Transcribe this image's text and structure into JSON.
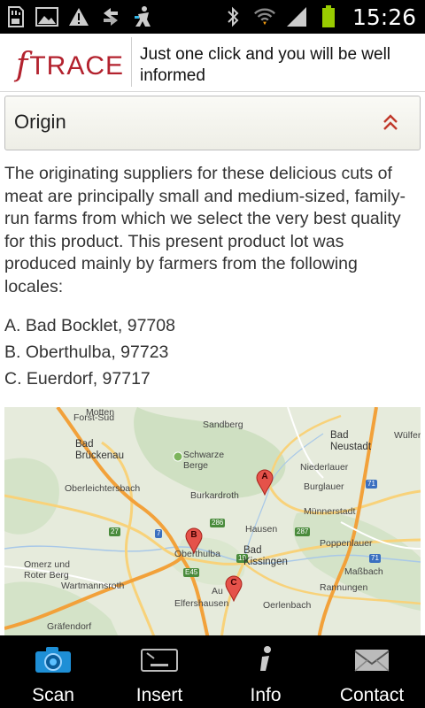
{
  "status_bar": {
    "time": "15:26"
  },
  "header": {
    "logo_f": "f",
    "logo_text": "TRACE",
    "tagline": "Just one click and you will be well informed"
  },
  "section": {
    "title": "Origin"
  },
  "body_text": "The originating suppliers for these delicious cuts of meat are principally small and medium-sized, family-run farms from which we select the very best quality for this product. This present product lot was produced mainly by farmers from the following locales:",
  "locales": [
    "A. Bad Bocklet, 97708",
    "B. Oberthulba, 97723",
    "C. Euerdorf, 97717"
  ],
  "map": {
    "markers": [
      "A",
      "B",
      "C"
    ],
    "place_labels": {
      "motten": "Motten",
      "forst_sud": "Forst-Sud",
      "sandberg": "Sandberg",
      "bad_neustadt": "Bad\nNeustadt",
      "wulfershausen": "Wülfers",
      "bad_bruckenau": "Bad\nBrückenau",
      "schwarze_berge": "Schwarze\nBerge",
      "niederlauer": "Niederlauer",
      "burglauer": "Burglauer",
      "oberleichtersbach": "Oberleichtersbach",
      "burkardroth": "Burkardroth",
      "munnerstadt": "Münnerstadt",
      "hausen": "Hausen",
      "bad_kissingen": "Bad\nKissingen",
      "poppenlauer": "Poppenlauer",
      "omerz": "Omerz und\nRoter Berg",
      "oberthulba": "Oberthulba",
      "massbach": "Maßbach",
      "wartmannsroth": "Wartmannsroth",
      "rannungen": "Rannungen",
      "elfershausen": "Elfershausen",
      "oerlenbach": "Oerlenbach",
      "grafendorf": "Gräfendorf",
      "aura": "Au"
    },
    "road_shields": [
      "27",
      "7",
      "286",
      "287",
      "71",
      "E45",
      "19",
      "71"
    ]
  },
  "nav": [
    {
      "label": "Scan",
      "icon": "camera-icon"
    },
    {
      "label": "Insert",
      "icon": "keyboard-icon"
    },
    {
      "label": "Info",
      "icon": "info-icon"
    },
    {
      "label": "Contact",
      "icon": "mail-icon"
    }
  ],
  "colors": {
    "brand": "#b3222e",
    "marker": "#e5524a",
    "nav_bg": "#000000",
    "accent_blue": "#33b5e5"
  }
}
